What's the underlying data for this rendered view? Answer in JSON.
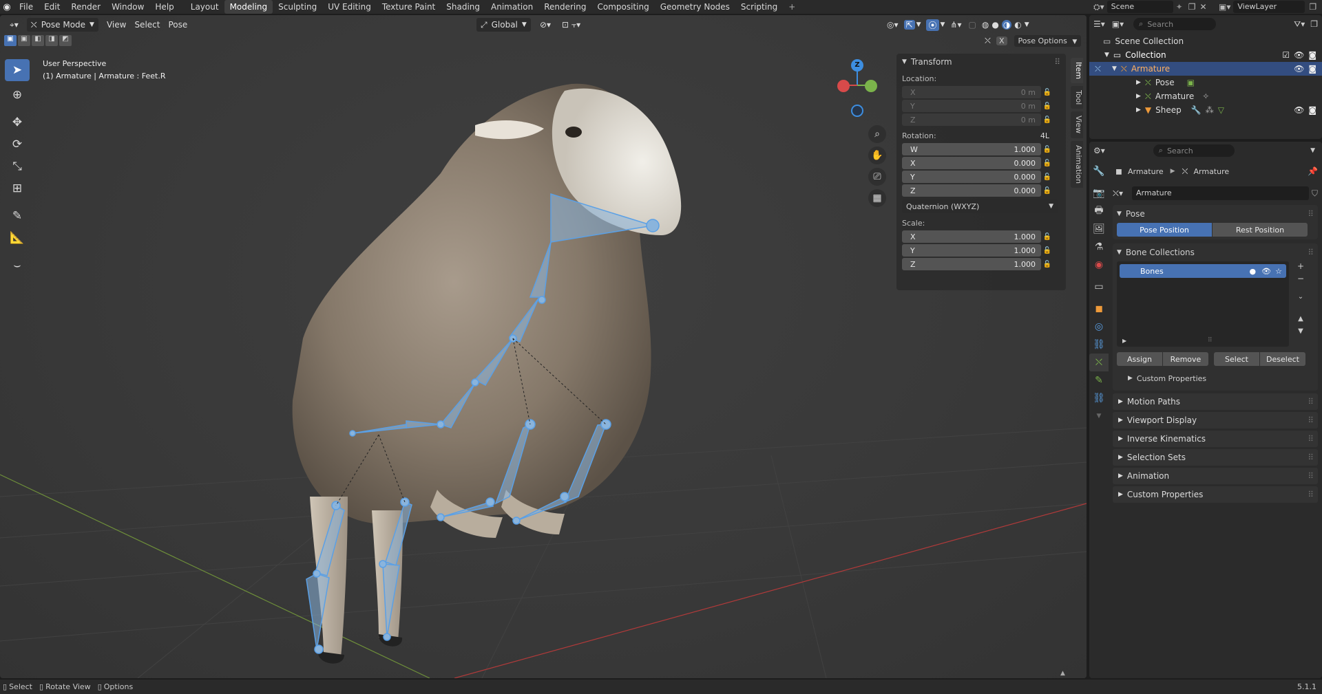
{
  "menu": [
    "File",
    "Edit",
    "Render",
    "Window",
    "Help"
  ],
  "workspaces": [
    "Layout",
    "Modeling",
    "Sculpting",
    "UV Editing",
    "Texture Paint",
    "Shading",
    "Animation",
    "Rendering",
    "Compositing",
    "Geometry Nodes",
    "Scripting"
  ],
  "active_workspace": "Modeling",
  "scene": {
    "name": "Scene",
    "view_layer": "ViewLayer"
  },
  "viewport": {
    "mode": "Pose Mode",
    "menus": [
      "View",
      "Select",
      "Pose"
    ],
    "transform_orientation": "Global",
    "pose_options": "Pose Options",
    "perspective_label": "User Perspective",
    "context_label": "(1) Armature | Armature : Feet.R",
    "n_tabs": [
      "Item",
      "Tool",
      "View",
      "Animation"
    ],
    "gizmo": {
      "x": "X",
      "y": "Y",
      "z": "Z"
    }
  },
  "transform_panel": {
    "title": "Transform",
    "location_label": "Location:",
    "location": [
      {
        "axis": "X",
        "value": "0 m"
      },
      {
        "axis": "Y",
        "value": "0 m"
      },
      {
        "axis": "Z",
        "value": "0 m"
      }
    ],
    "rotation_label": "Rotation:",
    "rotation_mode_badge": "4L",
    "rotation": [
      {
        "axis": "W",
        "value": "1.000"
      },
      {
        "axis": "X",
        "value": "0.000"
      },
      {
        "axis": "Y",
        "value": "0.000"
      },
      {
        "axis": "Z",
        "value": "0.000"
      }
    ],
    "rotation_mode": "Quaternion (WXYZ)",
    "scale_label": "Scale:",
    "scale": [
      {
        "axis": "X",
        "value": "1.000"
      },
      {
        "axis": "Y",
        "value": "1.000"
      },
      {
        "axis": "Z",
        "value": "1.000"
      }
    ]
  },
  "outliner": {
    "search_placeholder": "Search",
    "root": "Scene Collection",
    "collection": "Collection",
    "items": [
      {
        "name": "Armature",
        "level": 1,
        "selected": true
      },
      {
        "name": "Pose",
        "level": 2
      },
      {
        "name": "Armature",
        "level": 2
      },
      {
        "name": "Sheep",
        "level": 2
      }
    ]
  },
  "properties": {
    "search_placeholder": "Search",
    "breadcrumb": [
      "Armature",
      "Armature"
    ],
    "datablock_name": "Armature",
    "pose_section": "Pose",
    "pose_position": "Pose Position",
    "rest_position": "Rest Position",
    "bone_collections_section": "Bone Collections",
    "bone_collection_item": "Bones",
    "assign": "Assign",
    "remove": "Remove",
    "select": "Select",
    "deselect": "Deselect",
    "custom_properties_inner": "Custom Properties",
    "sections": [
      "Motion Paths",
      "Viewport Display",
      "Inverse Kinematics",
      "Selection Sets",
      "Animation",
      "Custom Properties"
    ]
  },
  "statusbar": {
    "items": [
      "Select",
      "Rotate View",
      "Options"
    ],
    "version": "5.1.1"
  },
  "colors": {
    "accent": "#4772b3",
    "bone": "#8ab4dc",
    "bone_edge": "#5aa0e6",
    "axis_x": "#d84a4a",
    "axis_y": "#7bb34b",
    "axis_z": "#3d8ee0"
  }
}
